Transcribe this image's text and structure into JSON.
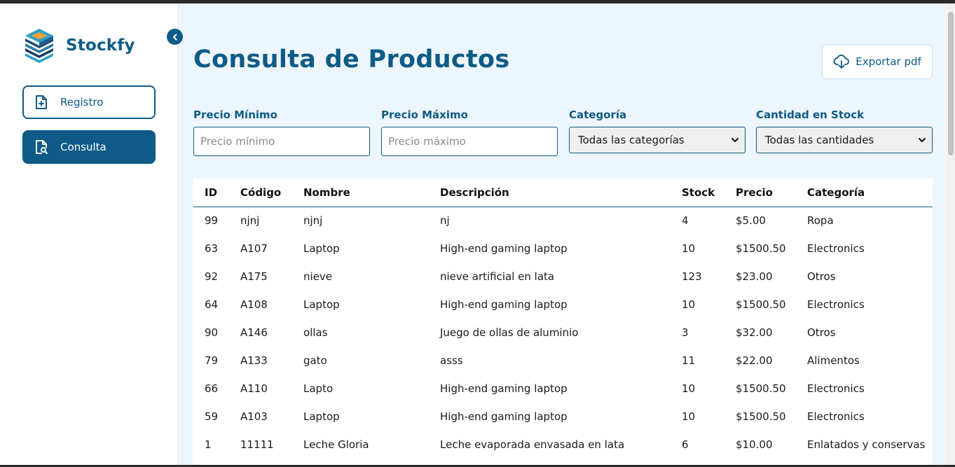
{
  "app": {
    "brand_name": "Stockfy"
  },
  "sidebar": {
    "items": [
      {
        "label": "Registro",
        "icon": "file-plus-icon",
        "active": false
      },
      {
        "label": "Consulta",
        "icon": "file-search-icon",
        "active": true
      }
    ]
  },
  "header": {
    "title": "Consulta de Productos",
    "export_label": "Exportar pdf"
  },
  "filters": {
    "min_price": {
      "label": "Precio Mínimo",
      "placeholder": "Precio mínimo",
      "value": ""
    },
    "max_price": {
      "label": "Precio Máximo",
      "placeholder": "Precio máximo",
      "value": ""
    },
    "category": {
      "label": "Categoría",
      "selected": "Todas las categorías"
    },
    "stock": {
      "label": "Cantidad en Stock",
      "selected": "Todas las cantidades"
    }
  },
  "table": {
    "headers": [
      "ID",
      "Código",
      "Nombre",
      "Descripción",
      "Stock",
      "Precio",
      "Categoría"
    ],
    "rows": [
      [
        "99",
        "njnj",
        "njnj",
        "nj",
        "4",
        "$5.00",
        "Ropa"
      ],
      [
        "63",
        "A107",
        "Laptop",
        "High-end gaming laptop",
        "10",
        "$1500.50",
        "Electronics"
      ],
      [
        "92",
        "A175",
        "nieve",
        "nieve artificial en lata",
        "123",
        "$23.00",
        "Otros"
      ],
      [
        "64",
        "A108",
        "Laptop",
        "High-end gaming laptop",
        "10",
        "$1500.50",
        "Electronics"
      ],
      [
        "90",
        "A146",
        "ollas",
        "Juego de ollas de aluminio",
        "3",
        "$32.00",
        "Otros"
      ],
      [
        "79",
        "A133",
        "gato",
        "asss",
        "11",
        "$22.00",
        "Alimentos"
      ],
      [
        "66",
        "A110",
        "Lapto",
        "High-end gaming laptop",
        "10",
        "$1500.50",
        "Electronics"
      ],
      [
        "59",
        "A103",
        "Laptop",
        "High-end gaming laptop",
        "10",
        "$1500.50",
        "Electronics"
      ],
      [
        "1",
        "11111",
        "Leche Gloria",
        "Leche evaporada envasada en lata",
        "6",
        "$10.00",
        "Enlatados y conservas"
      ]
    ]
  },
  "colors": {
    "primary": "#0d5b86",
    "background": "#eef6fd"
  }
}
